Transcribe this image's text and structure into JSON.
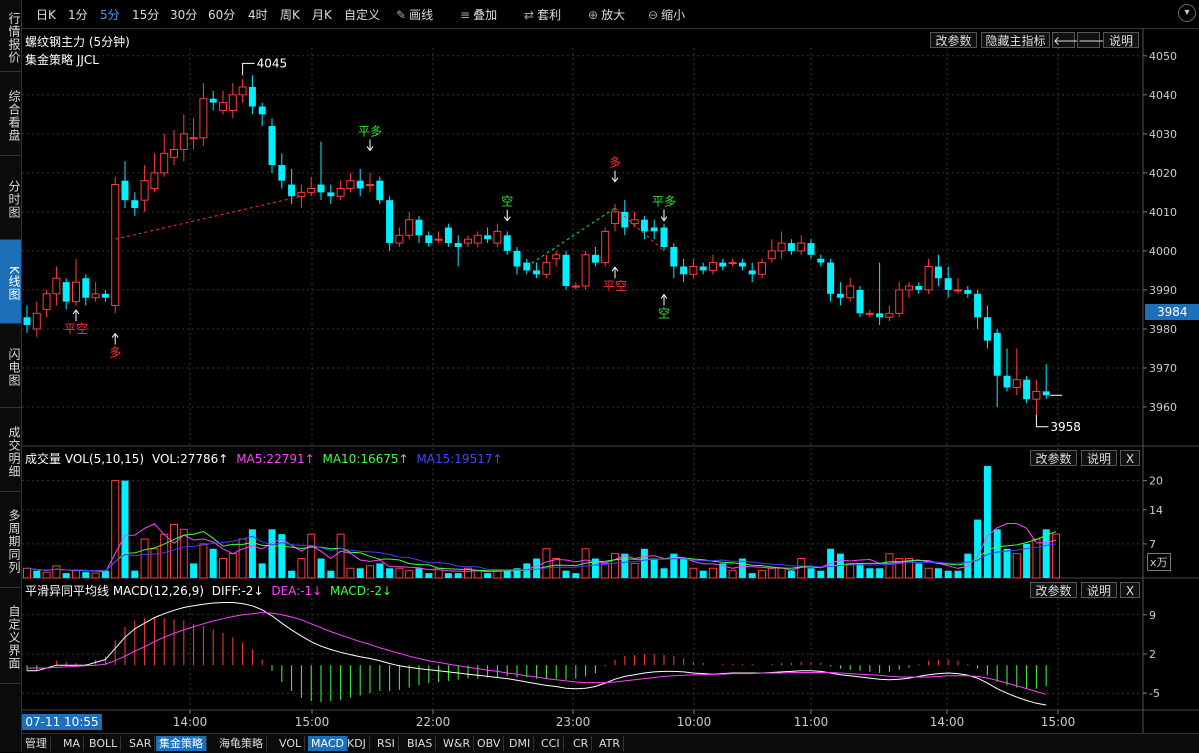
{
  "nav": [
    "行情报价",
    "综合看盘",
    "分时图",
    "K线图",
    "闪电图",
    "成交明细",
    "多周期同列",
    "自定义界面"
  ],
  "nav_active": 3,
  "toolbar": {
    "periods": [
      "日K",
      "1分",
      "5分",
      "15分",
      "30分",
      "60分",
      "4时",
      "周K",
      "月K",
      "自定义"
    ],
    "period_active": 2,
    "tools": [
      {
        "label": "画线",
        "icon": "pencil-icon",
        "glyph": "✎"
      },
      {
        "label": "叠加",
        "icon": "layers-icon",
        "glyph": "≡"
      },
      {
        "label": "套利",
        "icon": "arbitrage-icon",
        "glyph": "⇄"
      },
      {
        "label": "放大",
        "icon": "zoom-in-icon",
        "glyph": "⊕"
      },
      {
        "label": "缩小",
        "icon": "zoom-out-icon",
        "glyph": "⊖"
      }
    ]
  },
  "main_panel": {
    "title": "螺纹钢主力 (5分钟)",
    "strategy": "集金策略 JJCL",
    "buttons": {
      "params": "改参数",
      "hide": "隐藏主指标",
      "explain": "说明"
    },
    "price_axis": [
      "4050",
      "4040",
      "4030",
      "4020",
      "4010",
      "4000",
      "3990",
      "3980",
      "3970",
      "3960"
    ],
    "current_price": "3984",
    "high_label": "4045",
    "low_label": "3958",
    "signals": [
      {
        "text": "平空",
        "color": "#ff3030"
      },
      {
        "text": "多",
        "color": "#ff3030"
      },
      {
        "text": "平多",
        "color": "#30e030"
      },
      {
        "text": "空",
        "color": "#30e030"
      },
      {
        "text": "多",
        "color": "#ff3030"
      },
      {
        "text": "平空",
        "color": "#ff3030"
      },
      {
        "text": "平多",
        "color": "#30e030"
      },
      {
        "text": "空",
        "color": "#30e030"
      }
    ]
  },
  "vol_panel": {
    "title": "成交量 VOL(5,10,15)",
    "vol": "VOL:27786↑",
    "ma5": "MA5:22791↑",
    "ma10": "MA10:16675↑",
    "ma15": "MA15:19517↑",
    "axis": [
      "20",
      "14",
      "7"
    ],
    "unit": "x万",
    "buttons": {
      "params": "改参数",
      "explain": "说明",
      "close": "X"
    }
  },
  "macd_panel": {
    "title": "平滑异同平均线 MACD(12,26,9)",
    "diff": "DIFF:-2↓",
    "dea": "DEA:-1↓",
    "macd": "MACD:-2↓",
    "axis": [
      "9",
      "2",
      "-5"
    ],
    "buttons": {
      "params": "改参数",
      "explain": "说明",
      "close": "X"
    }
  },
  "time_axis": {
    "current": "07-11 10:55",
    "labels": [
      "14:00",
      "15:00",
      "22:00",
      "23:00",
      "10:00",
      "11:00",
      "14:00",
      "15:00"
    ]
  },
  "bottom_tabs": [
    "管理",
    "MA",
    "BOLL",
    "SAR",
    "集金策略",
    "海龟策略",
    "VOL",
    "MACD",
    "KDJ",
    "RSI",
    "BIAS",
    "W&R",
    "OBV",
    "DMI",
    "CCI",
    "CR",
    "ATR"
  ],
  "bottom_active": "MACD",
  "bottom_strategy": "集金策略",
  "colors": {
    "up": "#ff3b3b",
    "down": "#00f0ff",
    "ma5": "#ff40ff",
    "ma10": "#40ff40",
    "ma15": "#4040ff",
    "accent": "#1c6fb8"
  },
  "chart_data": {
    "type": "candlestick",
    "ylim": [
      3950,
      4052
    ],
    "candles": [
      [
        3983,
        3981,
        3986,
        3979
      ],
      [
        3980,
        3984,
        3987,
        3978
      ],
      [
        3985,
        3989,
        3990,
        3983
      ],
      [
        3989,
        3993,
        3996,
        3986
      ],
      [
        3992,
        3987,
        3993,
        3985
      ],
      [
        3987,
        3992,
        3998,
        3986
      ],
      [
        3993,
        3988,
        3994,
        3986
      ],
      [
        3988,
        3989,
        3992,
        3987
      ],
      [
        3989,
        3988,
        3990,
        3987
      ],
      [
        3986,
        4017,
        4019,
        3984
      ],
      [
        4018,
        4013,
        4023,
        4011
      ],
      [
        4013,
        4011,
        4015,
        4009
      ],
      [
        4013,
        4018,
        4022,
        4010
      ],
      [
        4016,
        4020,
        4025,
        4015
      ],
      [
        4020,
        4025,
        4030,
        4019
      ],
      [
        4024,
        4026,
        4031,
        4022
      ],
      [
        4026,
        4030,
        4035,
        4023
      ],
      [
        4029,
        4029,
        4034,
        4026
      ],
      [
        4029,
        4039,
        4043,
        4027
      ],
      [
        4039,
        4038,
        4041,
        4036
      ],
      [
        4036,
        4038,
        4041,
        4035
      ],
      [
        4036,
        4040,
        4043,
        4034
      ],
      [
        4040,
        4042,
        4044,
        4038
      ],
      [
        4042,
        4037,
        4045,
        4035
      ],
      [
        4037,
        4035,
        4038,
        4032
      ],
      [
        4032,
        4022,
        4034,
        4020
      ],
      [
        4022,
        4018,
        4025,
        4016
      ],
      [
        4017,
        4014,
        4021,
        4012
      ],
      [
        4014,
        4015,
        4017,
        4011
      ],
      [
        4015,
        4016,
        4019,
        4014
      ],
      [
        4017,
        4015,
        4028,
        4013
      ],
      [
        4015,
        4014,
        4017,
        4012
      ],
      [
        4014,
        4016,
        4018,
        4013
      ],
      [
        4016,
        4018,
        4020,
        4015
      ],
      [
        4018,
        4016,
        4021,
        4014
      ],
      [
        4017,
        4017,
        4020,
        4015
      ],
      [
        4018,
        4013,
        4019,
        4012
      ],
      [
        4013,
        4002,
        4014,
        4000
      ],
      [
        4002,
        4004,
        4006,
        4001
      ],
      [
        4004,
        4008,
        4010,
        4003
      ],
      [
        4008,
        4004,
        4009,
        4002
      ],
      [
        4004,
        4002,
        4005,
        4001
      ],
      [
        4003,
        4003,
        4005,
        4002
      ],
      [
        4006,
        4002,
        4007,
        4001
      ],
      [
        4002,
        4001,
        4004,
        3996
      ],
      [
        4002,
        4003,
        4004,
        4001
      ],
      [
        4002,
        4004,
        4005,
        4001
      ],
      [
        4004,
        4003,
        4006,
        4002
      ],
      [
        4002,
        4005,
        4007,
        4001
      ],
      [
        4004,
        4000,
        4005,
        3999
      ],
      [
        4000,
        3996,
        4001,
        3994
      ],
      [
        3997,
        3995,
        3998,
        3994
      ],
      [
        3995,
        3994,
        3997,
        3993
      ],
      [
        3994,
        3997,
        3999,
        3993
      ],
      [
        3998,
        3999,
        4000,
        3996
      ],
      [
        3999,
        3991,
        4000,
        3990
      ],
      [
        3991,
        3991,
        3992,
        3990
      ],
      [
        3991,
        3999,
        4000,
        3990
      ],
      [
        3999,
        3997,
        4001,
        3996
      ],
      [
        3997,
        4005,
        4006,
        3996
      ],
      [
        4007,
        4010,
        4012,
        4005
      ],
      [
        4010,
        4006,
        4013,
        4004
      ],
      [
        4007,
        4008,
        4010,
        4006
      ],
      [
        4008,
        4005,
        4009,
        4003
      ],
      [
        4006,
        4005,
        4008,
        4003
      ],
      [
        4006,
        4001,
        4007,
        4000
      ],
      [
        4001,
        3996,
        4002,
        3993
      ],
      [
        3996,
        3994,
        3998,
        3992
      ],
      [
        3994,
        3996,
        3998,
        3993
      ],
      [
        3996,
        3995,
        3997,
        3994
      ],
      [
        3995,
        3997,
        3999,
        3994
      ],
      [
        3997,
        3996,
        3998,
        3995
      ],
      [
        3997,
        3997,
        3998,
        3996
      ],
      [
        3997,
        3996,
        3998,
        3995
      ],
      [
        3995,
        3994,
        3997,
        3992
      ],
      [
        3994,
        3997,
        3998,
        3993
      ],
      [
        3998,
        4000,
        4003,
        3997
      ],
      [
        4000,
        4002,
        4005,
        3998
      ],
      [
        4002,
        4000,
        4003,
        3999
      ],
      [
        4000,
        4002,
        4004,
        3999
      ],
      [
        4002,
        3999,
        4003,
        3998
      ],
      [
        3998,
        3997,
        3999,
        3996
      ],
      [
        3997,
        3989,
        3998,
        3987
      ],
      [
        3989,
        3988,
        3992,
        3986
      ],
      [
        3988,
        3991,
        3993,
        3987
      ],
      [
        3990,
        3984,
        3991,
        3983
      ],
      [
        3984,
        3984,
        3985,
        3983
      ],
      [
        3984,
        3983,
        3997,
        3981
      ],
      [
        3983,
        3984,
        3986,
        3982
      ],
      [
        3984,
        3990,
        3992,
        3983
      ],
      [
        3990,
        3991,
        3992,
        3988
      ],
      [
        3991,
        3990,
        3992,
        3989
      ],
      [
        3990,
        3996,
        3998,
        3989
      ],
      [
        3996,
        3993,
        3999,
        3991
      ],
      [
        3993,
        3990,
        3996,
        3988
      ],
      [
        3990,
        3990,
        3993,
        3989
      ],
      [
        3990,
        3989,
        3991,
        3988
      ],
      [
        3989,
        3983,
        3990,
        3980
      ],
      [
        3983,
        3977,
        3986,
        3975
      ],
      [
        3979,
        3968,
        3980,
        3960
      ],
      [
        3968,
        3965,
        3975,
        3964
      ],
      [
        3965,
        3967,
        3975,
        3963
      ],
      [
        3967,
        3962,
        3968,
        3961
      ],
      [
        3962,
        3964,
        3967,
        3958
      ],
      [
        3964,
        3963,
        3971,
        3962
      ]
    ],
    "volume": [
      2,
      1.5,
      1.2,
      2.5,
      1,
      1.5,
      1.2,
      1,
      1.5,
      20,
      20,
      1.5,
      8,
      6,
      9,
      11,
      10,
      3,
      7,
      6,
      4,
      5,
      8,
      10,
      3,
      10,
      9,
      1.5,
      4,
      9,
      4,
      1.5,
      9,
      2,
      2,
      2.5,
      3,
      2,
      2,
      1.5,
      2,
      1,
      2,
      1,
      1,
      2,
      1.5,
      1,
      1.5,
      1.5,
      2,
      3,
      4,
      6,
      4,
      1.5,
      1,
      6,
      4,
      3,
      5,
      5,
      3,
      6,
      4,
      2,
      5,
      4,
      2,
      1.5,
      2,
      3,
      1.5,
      4,
      1,
      1.5,
      2,
      2,
      1.5,
      4,
      2,
      1.5,
      6,
      5,
      3,
      3,
      2,
      2,
      5,
      4,
      4,
      3,
      2,
      2,
      1.5,
      1.5,
      5,
      12,
      23,
      10,
      6,
      5,
      7,
      8,
      10,
      9
    ],
    "volume_up": [
      true,
      false,
      true,
      true,
      false,
      true,
      false,
      true,
      false,
      true,
      false,
      false,
      true,
      true,
      true,
      true,
      true,
      false,
      true,
      false,
      true,
      true,
      true,
      false,
      false,
      false,
      false,
      false,
      true,
      true,
      false,
      false,
      true,
      true,
      false,
      true,
      false,
      false,
      true,
      true,
      false,
      false,
      true,
      false,
      false,
      true,
      true,
      false,
      true,
      false,
      false,
      false,
      false,
      true,
      true,
      false,
      false,
      true,
      false,
      true,
      true,
      false,
      true,
      false,
      false,
      false,
      false,
      false,
      true,
      false,
      true,
      false,
      true,
      false,
      false,
      true,
      true,
      true,
      false,
      true,
      false,
      false,
      false,
      false,
      true,
      false,
      false,
      false,
      true,
      true,
      true,
      false,
      true,
      false,
      false,
      false,
      false,
      false,
      false,
      false,
      false,
      true,
      false,
      true,
      false,
      true
    ],
    "vol_axis": [
      0,
      23
    ],
    "macd_diff": [
      -1,
      -1,
      -0.5,
      0,
      0,
      0,
      0,
      0.5,
      1,
      3,
      5,
      6.5,
      7.5,
      8.5,
      9.2,
      9.8,
      10.3,
      10.6,
      10.9,
      11.1,
      11.2,
      11.2,
      11,
      10.6,
      9.9,
      8.8,
      7.5,
      6.3,
      5.2,
      4.2,
      3.4,
      2.8,
      2.3,
      1.9,
      1.5,
      1.2,
      0.8,
      0.3,
      -0.1,
      -0.4,
      -0.6,
      -0.8,
      -1,
      -1.2,
      -1.4,
      -1.6,
      -1.8,
      -2,
      -2.2,
      -2.4,
      -2.7,
      -3,
      -3.3,
      -3.6,
      -3.8,
      -4.1,
      -4.2,
      -4.1,
      -3.8,
      -3.2,
      -2.5,
      -2,
      -1.7,
      -1.4,
      -1.2,
      -1.1,
      -1.1,
      -1.2,
      -1.4,
      -1.5,
      -1.6,
      -1.5,
      -1.4,
      -1.4,
      -1.4,
      -1.4,
      -1.3,
      -1.2,
      -1.1,
      -1.0,
      -1,
      -1.1,
      -1.4,
      -1.7,
      -1.9,
      -2.1,
      -2.3,
      -2.5,
      -2.6,
      -2.5,
      -2.3,
      -2,
      -1.7,
      -1.5,
      -1.4,
      -1.5,
      -1.8,
      -2.3,
      -3.2,
      -4.2,
      -5,
      -5.7,
      -6.3,
      -6.8,
      -7.1
    ],
    "macd_dea": [
      -0.5,
      -0.5,
      -0.5,
      -0.4,
      -0.3,
      -0.2,
      -0.1,
      0,
      0.2,
      0.8,
      1.6,
      2.5,
      3.3,
      4.2,
      5,
      5.7,
      6.3,
      6.9,
      7.4,
      7.9,
      8.3,
      8.7,
      9,
      9.2,
      9.4,
      9.3,
      9,
      8.6,
      8.1,
      7.4,
      6.7,
      6,
      5.4,
      4.8,
      4.2,
      3.7,
      3.1,
      2.6,
      2.1,
      1.6,
      1.2,
      0.8,
      0.5,
      0.2,
      -0.1,
      -0.4,
      -0.6,
      -0.9,
      -1.1,
      -1.4,
      -1.6,
      -1.9,
      -2.1,
      -2.4,
      -2.6,
      -2.8,
      -3,
      -3.1,
      -3.1,
      -3.1,
      -3,
      -2.8,
      -2.6,
      -2.4,
      -2.2,
      -2,
      -1.9,
      -1.8,
      -1.7,
      -1.7,
      -1.6,
      -1.6,
      -1.5,
      -1.5,
      -1.5,
      -1.4,
      -1.4,
      -1.4,
      -1.3,
      -1.3,
      -1.3,
      -1.3,
      -1.3,
      -1.4,
      -1.5,
      -1.6,
      -1.7,
      -1.8,
      -2,
      -2.1,
      -2.1,
      -2.1,
      -2.1,
      -2,
      -1.9,
      -1.9,
      -1.9,
      -2,
      -2.3,
      -2.7,
      -3.2,
      -3.7,
      -4.2,
      -4.7,
      -5.2
    ],
    "macd_ylim": [
      -8,
      12
    ],
    "annotations": [
      {
        "text": "4045",
        "index": 22,
        "price": 4045
      },
      {
        "text": "3958",
        "index": 103,
        "price": 3958
      }
    ]
  }
}
